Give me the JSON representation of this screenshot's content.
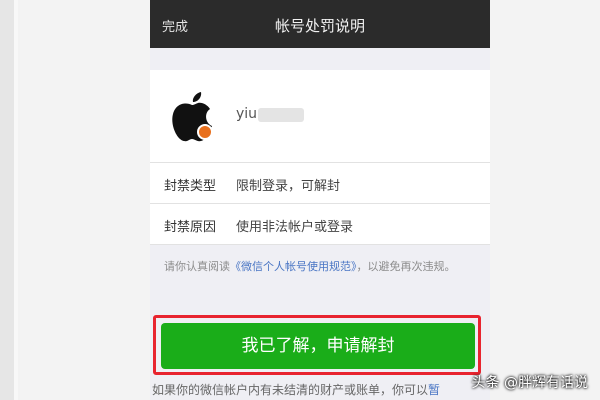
{
  "navbar": {
    "back_label": "完成",
    "title": "帐号处罚说明"
  },
  "account": {
    "name": "yiu"
  },
  "rows": [
    {
      "label": "封禁类型",
      "value": "限制登录，可解封"
    },
    {
      "label": "封禁原因",
      "value": "使用非法帐户或登录"
    }
  ],
  "notice": {
    "prefix": "请你认真阅读",
    "link": "《微信个人帐号使用规范》",
    "suffix": "，以避免再次违规。"
  },
  "primary_button": {
    "label": "我已了解，申请解封"
  },
  "footer": {
    "text": "如果你的微信帐户内有未结清的财产或账单，你可以",
    "link": "暂"
  },
  "watermark": {
    "text": "头条 @胖辉有话说"
  },
  "colors": {
    "navbar_bg": "#2b2b2b",
    "primary_green": "#1aad19",
    "highlight_red": "#e8242f",
    "link_blue": "#4a76c4"
  }
}
